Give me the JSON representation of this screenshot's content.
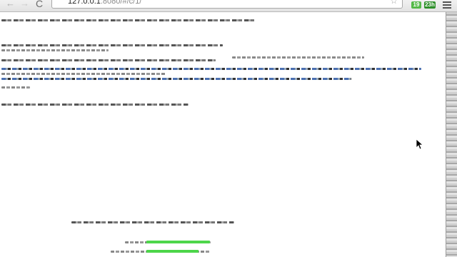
{
  "browser": {
    "url_host": "127.0.0.1",
    "url_rest": ":8080/#/c/1/",
    "nav": {
      "back_glyph": "←",
      "forward_glyph": "→",
      "reload_glyph": "C"
    },
    "star_glyph": "☆",
    "extensions": [
      {
        "icon": "extension-badge-icon",
        "count": "19"
      },
      {
        "icon": "extension-badge-icon",
        "count": "23h"
      }
    ],
    "menu_icon": "hamburger-menu-icon"
  },
  "page": {
    "progress_bars": [
      {
        "fraction": 0.55
      },
      {
        "fraction": 0.45
      }
    ]
  },
  "colors": {
    "progress_green": "#4dd64a",
    "link_blue": "#4a6fb0"
  }
}
